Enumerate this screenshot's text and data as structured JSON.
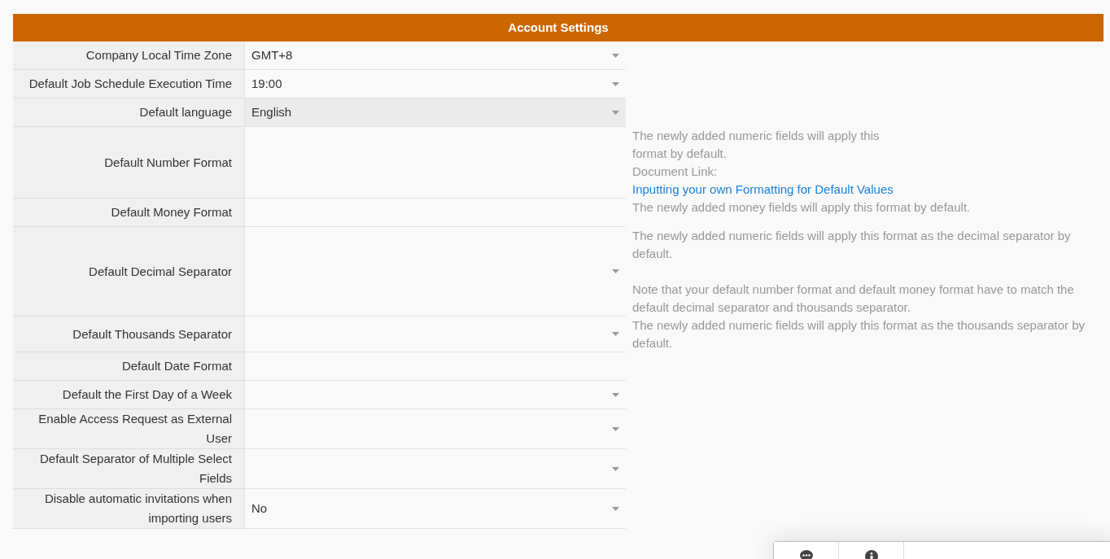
{
  "title": "Account Settings",
  "rows": [
    {
      "label": "Company Local Time Zone",
      "kind": "select",
      "value": "GMT+8",
      "highlighted": false
    },
    {
      "label": "Default Job Schedule Execution Time",
      "kind": "select",
      "value": "19:00",
      "highlighted": false
    },
    {
      "label": "Default language",
      "kind": "select",
      "value": "English",
      "highlighted": true
    },
    {
      "label": "Default Number Format",
      "kind": "text",
      "highlighted": false,
      "help": [
        {
          "text": "The newly added numeric fields will apply this format by default.",
          "link_label": "Document Link:",
          "link": "Inputting your own Formatting for Default Values"
        }
      ]
    },
    {
      "label": "Default Money Format",
      "kind": "text",
      "highlighted": false,
      "help": [
        {
          "text": "The newly added money fields will apply this format by default."
        }
      ]
    },
    {
      "label": "Default Decimal Separator",
      "kind": "select",
      "highlighted": false,
      "help": [
        {
          "text": "The newly added numeric fields will apply this format as the decimal separator by default."
        },
        {
          "text": "Note that your default number format and default money format have to match the default decimal separator and thousands separator."
        }
      ]
    },
    {
      "label": "Default Thousands Separator",
      "kind": "select",
      "highlighted": false,
      "help": [
        {
          "text": "The newly added numeric fields will apply this format as the thousands separator by default."
        }
      ]
    },
    {
      "label": "Default Date Format",
      "kind": "text",
      "highlighted": false
    },
    {
      "label": "Default the First Day of a Week",
      "kind": "select",
      "highlighted": false
    },
    {
      "label": "Enable Access Request as External User",
      "kind": "select",
      "highlighted": false
    },
    {
      "label": "Default Separator of Multiple Select Fields",
      "kind": "select",
      "highlighted": false
    },
    {
      "label": "Disable automatic invitations when importing users",
      "kind": "select",
      "value": "No",
      "highlighted": false
    }
  ]
}
